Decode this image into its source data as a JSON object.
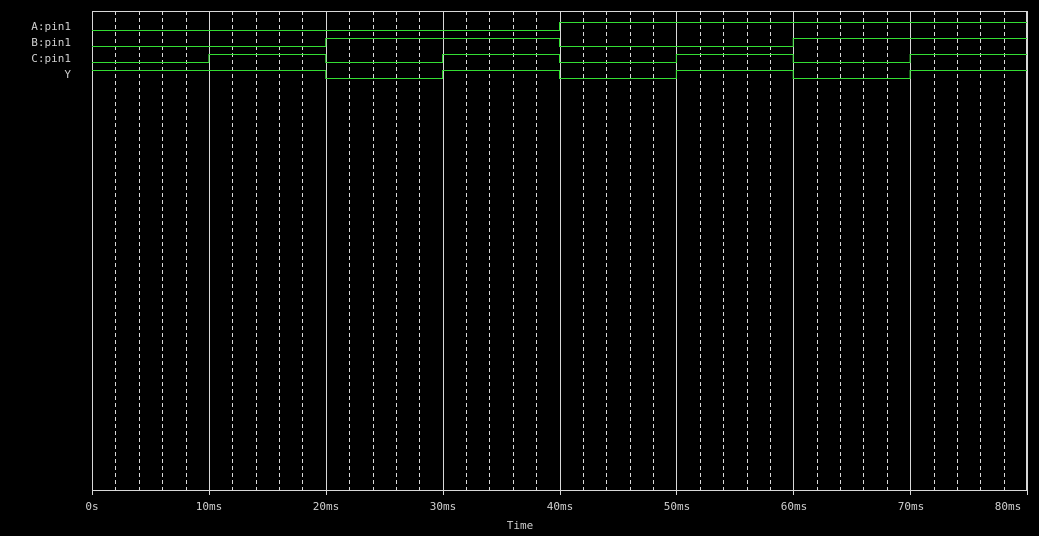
{
  "chart_data": {
    "type": "line",
    "title": "",
    "xlabel": "Time",
    "ylabel": "",
    "xlim": [
      0,
      80
    ],
    "x_unit": "ms",
    "tick_labels": [
      "0s",
      "10ms",
      "20ms",
      "30ms",
      "40ms",
      "50ms",
      "60ms",
      "70ms",
      "80ms"
    ],
    "ticks": [
      0,
      10,
      20,
      30,
      40,
      50,
      60,
      70,
      80
    ],
    "minor_grid_step": 2,
    "grid": true,
    "trace_color": "#33dd33",
    "grid_color": "#d8d8d8",
    "background": "#000000",
    "series": [
      {
        "name": "A:pin1",
        "transitions": [
          0,
          40,
          80
        ],
        "values": [
          0,
          1
        ]
      },
      {
        "name": "B:pin1",
        "transitions": [
          0,
          20,
          40,
          60,
          80
        ],
        "values": [
          0,
          1,
          0,
          1
        ]
      },
      {
        "name": "C:pin1",
        "transitions": [
          0,
          10,
          20,
          30,
          40,
          50,
          60,
          70,
          80
        ],
        "values": [
          0,
          1,
          0,
          1,
          0,
          1,
          0,
          1
        ]
      },
      {
        "name": "Y",
        "transitions": [
          0,
          20,
          30,
          40,
          50,
          60,
          70,
          80
        ],
        "values": [
          1,
          0,
          1,
          0,
          1,
          0,
          1
        ]
      }
    ]
  }
}
